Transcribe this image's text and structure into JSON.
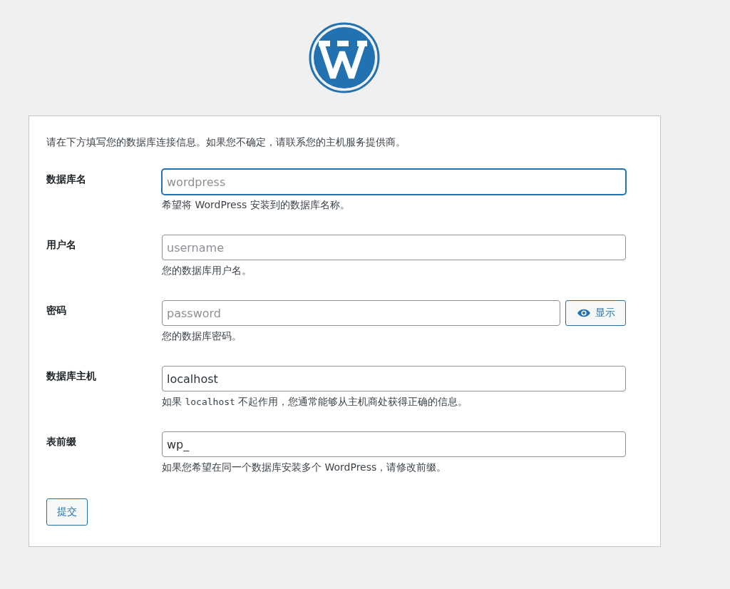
{
  "intro": "请在下方填写您的数据库连接信息。如果您不确定，请联系您的主机服务提供商。",
  "fields": [
    {
      "label": "数据库名",
      "placeholder": "wordpress",
      "focused": true,
      "hint": [
        {
          "kind": "text",
          "text": "希望将 WordPress 安装到的数据库名称。"
        }
      ]
    },
    {
      "label": "用户名",
      "placeholder": "username",
      "focused": false,
      "hint": [
        {
          "kind": "text",
          "text": "您的数据库用户名。"
        }
      ]
    },
    {
      "label": "密码",
      "placeholder": "password",
      "focused": false,
      "show_button": "显示",
      "hint": [
        {
          "kind": "text",
          "text": "您的数据库密码。"
        }
      ]
    },
    {
      "label": "数据库主机",
      "value": "localhost",
      "focused": false,
      "hint": [
        {
          "kind": "text",
          "text": "如果 "
        },
        {
          "kind": "code",
          "text": "localhost"
        },
        {
          "kind": "text",
          "text": " 不起作用，您通常能够从主机商处获得正确的信息。"
        }
      ]
    },
    {
      "label": "表前缀",
      "value": "wp_",
      "focused": false,
      "hint": [
        {
          "kind": "text",
          "text": "如果您希望在同一个数据库安装多个 WordPress，请修改前缀。"
        }
      ]
    }
  ],
  "submit": "提交"
}
